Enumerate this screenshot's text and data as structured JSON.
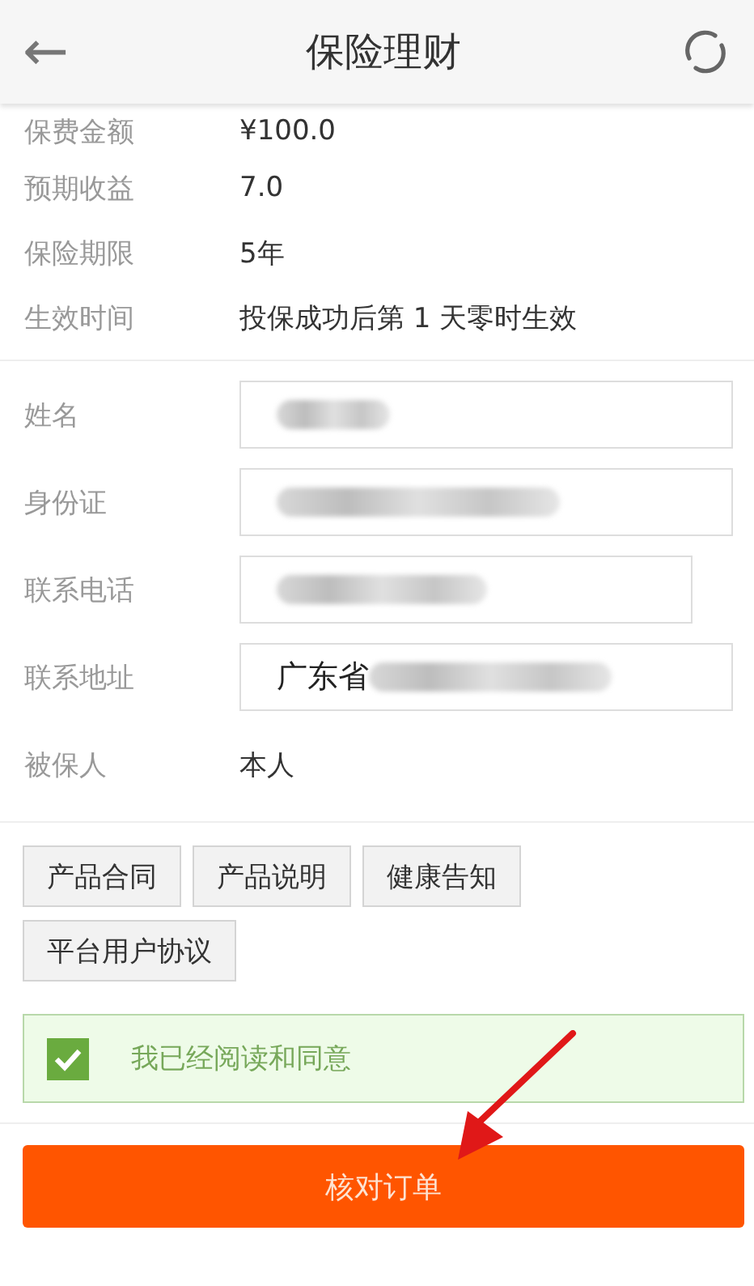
{
  "header": {
    "back": "←",
    "title": "保险理财"
  },
  "details": [
    {
      "label": "保费金额",
      "value": "¥100.0"
    },
    {
      "label": "预期收益",
      "value": "7.0"
    },
    {
      "label": "保险期限",
      "value": "5年"
    },
    {
      "label": "生效时间",
      "value": "投保成功后第 1 天零时生效"
    }
  ],
  "form": [
    {
      "label": "姓名",
      "kind": "field",
      "redacted": true
    },
    {
      "label": "身份证",
      "kind": "field",
      "redacted": true
    },
    {
      "label": "联系电话",
      "kind": "field",
      "redacted": true,
      "narrow": true
    },
    {
      "label": "联系地址",
      "kind": "field",
      "value": "广东省",
      "redacted": true
    },
    {
      "label": "被保人",
      "kind": "text",
      "value": "本人"
    }
  ],
  "documents": [
    "产品合同",
    "产品说明",
    "健康告知",
    "平台用户协议"
  ],
  "agreement": {
    "label": "我已经阅读和同意",
    "checked": true
  },
  "submit": "核对订单",
  "annotation": {
    "kind": "arrow"
  }
}
